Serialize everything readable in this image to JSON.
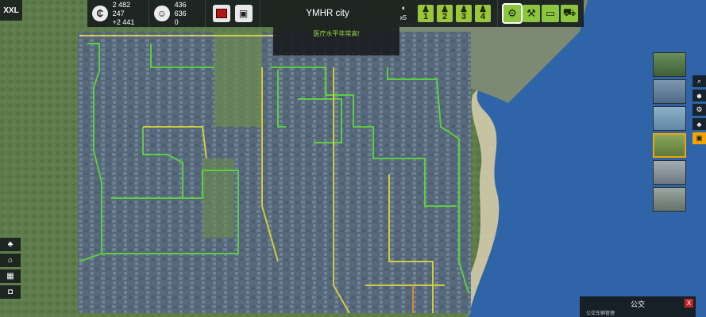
{
  "hud": {
    "size_label": "XXL",
    "money_icon": "currency-icon",
    "money": "2 482 247",
    "money_delta": "+2 441",
    "population_icon": "people-icon",
    "population": "436 636",
    "population_delta": "0",
    "city_name": "YMHR city",
    "speed_label": "x5",
    "pause_icon": "pause-icon",
    "speed_buttons": [
      "1",
      "2",
      "3",
      "4"
    ],
    "tool_icons": [
      "settings-icon",
      "worker-icon",
      "bed-icon",
      "cart-icon"
    ]
  },
  "notification": "医疗水平非常高!",
  "left_tools": [
    "tree-icon",
    "home-icon",
    "building-icon",
    "bag-icon"
  ],
  "right_tools": [
    "search-icon",
    "people-icon",
    "settings-icon",
    "tree-icon",
    "bus-icon"
  ],
  "panel": {
    "title": "公交",
    "close_label": "X",
    "row_text": "公交车辆管理"
  },
  "colors": {
    "route_green": "#5fd33a",
    "route_yellow": "#d8d23a",
    "route_orange": "#e48a2a",
    "water": "#2f64a8",
    "accent": "#f4a400"
  }
}
